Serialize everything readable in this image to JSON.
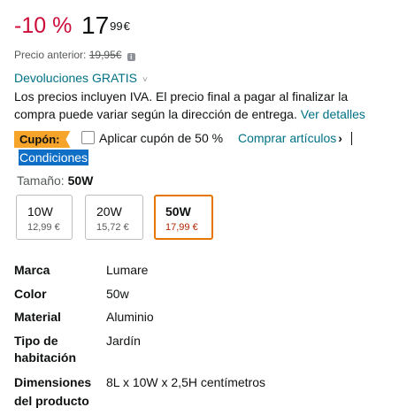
{
  "price_block": {
    "discount": "-10 %",
    "price_whole": "17",
    "price_fraction": "99",
    "currency": "€",
    "previous_label": "Precio anterior:",
    "previous_price": "19,95€",
    "info_icon": "info-icon"
  },
  "returns": {
    "label": "Devoluciones GRATIS",
    "chevron": "˅"
  },
  "tax_notice": {
    "text": "Los precios incluyen IVA. El precio final a pagar al finalizar la compra puede variar según la dirección de entrega.",
    "link": "Ver detalles"
  },
  "coupon": {
    "badge": "Cupón:",
    "checkbox_checked": false,
    "apply_text": "Aplicar cupón de 50 %",
    "shop_link": "Comprar artículos",
    "shop_arrow": "›",
    "conditions": "Condiciones"
  },
  "size": {
    "label": "Tamaño:",
    "selected": "50W",
    "options": [
      {
        "name": "10W",
        "price": "12,99 €",
        "selected": false
      },
      {
        "name": "20W",
        "price": "15,72 €",
        "selected": false
      },
      {
        "name": "50W",
        "price": "17,99 €",
        "selected": true
      }
    ]
  },
  "attributes": [
    {
      "key": "Marca",
      "value": "Lumare"
    },
    {
      "key": "Color",
      "value": "50w"
    },
    {
      "key": "Material",
      "value": "Aluminio"
    },
    {
      "key_lines": [
        "Tipo de",
        "habitación"
      ],
      "value": "Jardín"
    },
    {
      "key_lines": [
        "Dimensiones",
        "del producto"
      ],
      "value": "8L x 10W x 2,5H centímetros"
    }
  ],
  "colors": {
    "discount": "#cc0c39",
    "link": "#007185",
    "coupon_badge": "#f7a42a",
    "selected_border": "#e77600",
    "selected_price": "#b12704",
    "selection_highlight": "#0f6fc6"
  }
}
